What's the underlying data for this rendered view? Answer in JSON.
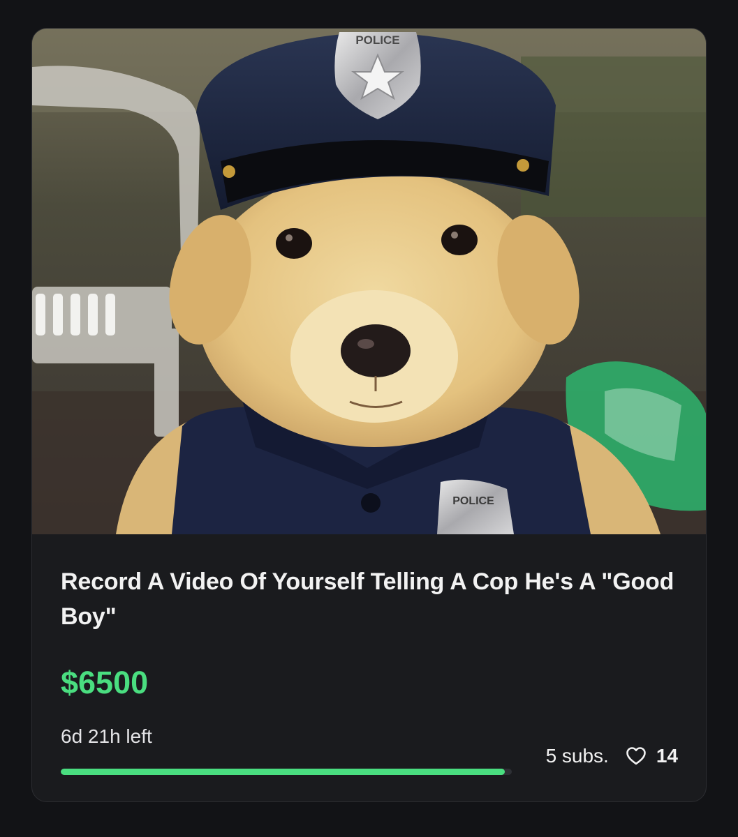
{
  "listing": {
    "image_alt": "Golden retriever puppy wearing a police hat and uniform",
    "image_badge_text": "POLICE",
    "title": "Record A Video Of Yourself Telling A Cop He's A \"Good Boy\"",
    "price": "$6500",
    "time_left": "6d 21h left",
    "progress": 0.985,
    "submissions": "5 subs.",
    "likes": "14",
    "like_icon": "heart-outline-icon"
  },
  "colors": {
    "background": "#121316",
    "card": "#1a1b1e",
    "accent_green": "#4ade80",
    "text": "#f2f2f2"
  }
}
